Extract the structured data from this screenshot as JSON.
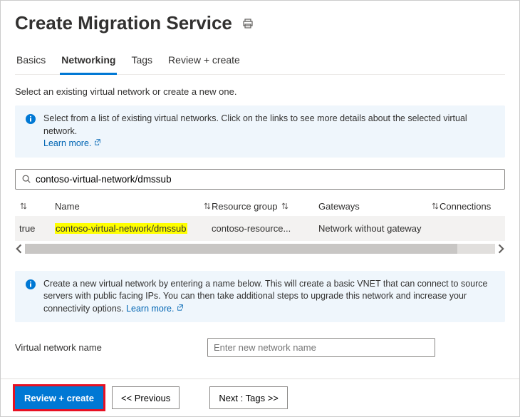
{
  "header": {
    "title": "Create Migration Service"
  },
  "tabs": [
    {
      "label": "Basics",
      "active": false
    },
    {
      "label": "Networking",
      "active": true
    },
    {
      "label": "Tags",
      "active": false
    },
    {
      "label": "Review + create",
      "active": false
    }
  ],
  "subhead": "Select an existing virtual network or create a new one.",
  "infobox1": {
    "text": "Select from a list of existing virtual networks. Click on the links to see more details about the selected virtual network.",
    "learn_more": "Learn more."
  },
  "search": {
    "value": "contoso-virtual-network/dmssub"
  },
  "table": {
    "columns": {
      "c1": "",
      "c2": "Name",
      "c3": "Resource group",
      "c4": "Gateways",
      "c5": "Connections"
    },
    "rows": [
      {
        "c1": "true",
        "c2": "contoso-virtual-network/dmssub",
        "c3": "contoso-resource...",
        "c4": "Network without gateway",
        "c5": ""
      }
    ]
  },
  "infobox2": {
    "text": "Create a new virtual network by entering a name below. This will create a basic VNET that can connect to source servers with public facing IPs. You can then take additional steps to upgrade this network and increase your connectivity options.",
    "learn_more": "Learn more."
  },
  "form": {
    "vnet_label": "Virtual network name",
    "vnet_placeholder": "Enter new network name",
    "vnet_value": ""
  },
  "footer": {
    "review_create": "Review + create",
    "previous": "<<  Previous",
    "next": "Next : Tags >>"
  }
}
